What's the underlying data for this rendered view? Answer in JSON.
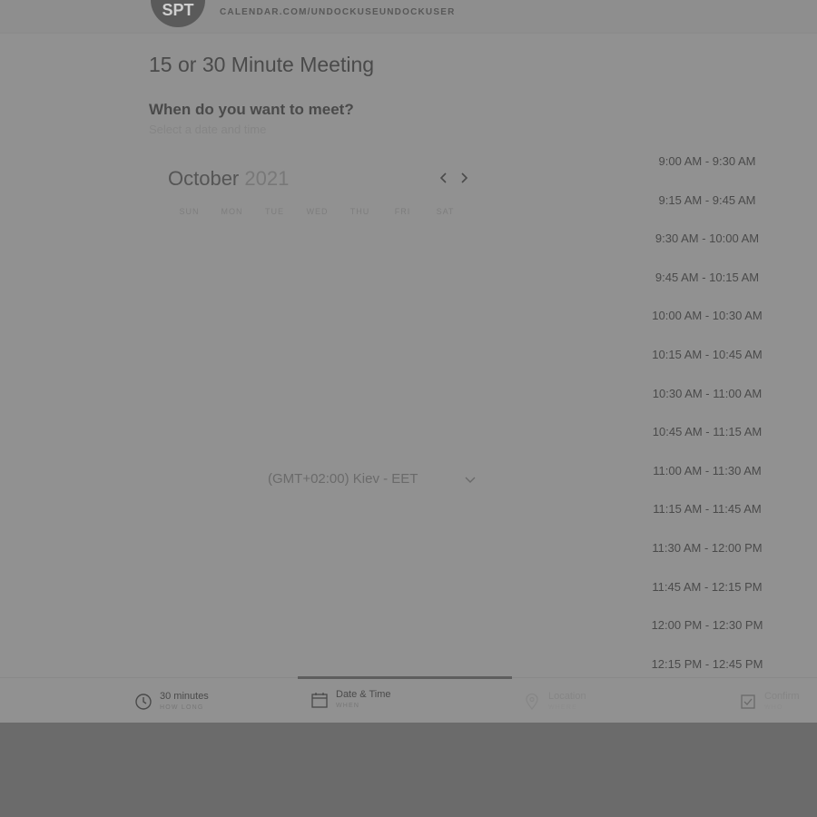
{
  "header": {
    "avatar_initials": "SPT",
    "url": "CALENDAR.COM/UNDOCKUSEUNDOCKUSER"
  },
  "meeting": {
    "title": "15 or 30 Minute Meeting",
    "prompt": "When do you want to meet?",
    "prompt_sub": "Select a date and time"
  },
  "calendar": {
    "month": "October",
    "year": "2021",
    "prev_icon": "chevron-left-icon",
    "next_icon": "chevron-right-icon",
    "weekdays": [
      "SUN",
      "MON",
      "TUE",
      "WED",
      "THU",
      "FRI",
      "SAT"
    ]
  },
  "timezone": {
    "value": "(GMT+02:00) Kiev - EET"
  },
  "time_slots": [
    "9:00 AM - 9:30 AM",
    "9:15 AM - 9:45 AM",
    "9:30 AM - 10:00 AM",
    "9:45 AM - 10:15 AM",
    "10:00 AM - 10:30 AM",
    "10:15 AM - 10:45 AM",
    "10:30 AM - 11:00 AM",
    "10:45 AM - 11:15 AM",
    "11:00 AM - 11:30 AM",
    "11:15 AM - 11:45 AM",
    "11:30 AM - 12:00 PM",
    "11:45 AM - 12:15 PM",
    "12:00 PM - 12:30 PM",
    "12:15 PM - 12:45 PM"
  ],
  "steps": [
    {
      "label": "30 minutes",
      "sub": "HOW LONG",
      "icon": "clock-icon"
    },
    {
      "label": "Date & Time",
      "sub": "WHEN",
      "icon": "calendar-icon"
    },
    {
      "label": "Location",
      "sub": "WHERE",
      "icon": "location-pin-icon"
    },
    {
      "label": "Confirm",
      "sub": "WHO",
      "icon": "confirm-icon"
    }
  ],
  "colors": {
    "overlay_background": "#919191",
    "bottom_background": "#6b6b6b",
    "text_dark": "#4a4a4a"
  }
}
